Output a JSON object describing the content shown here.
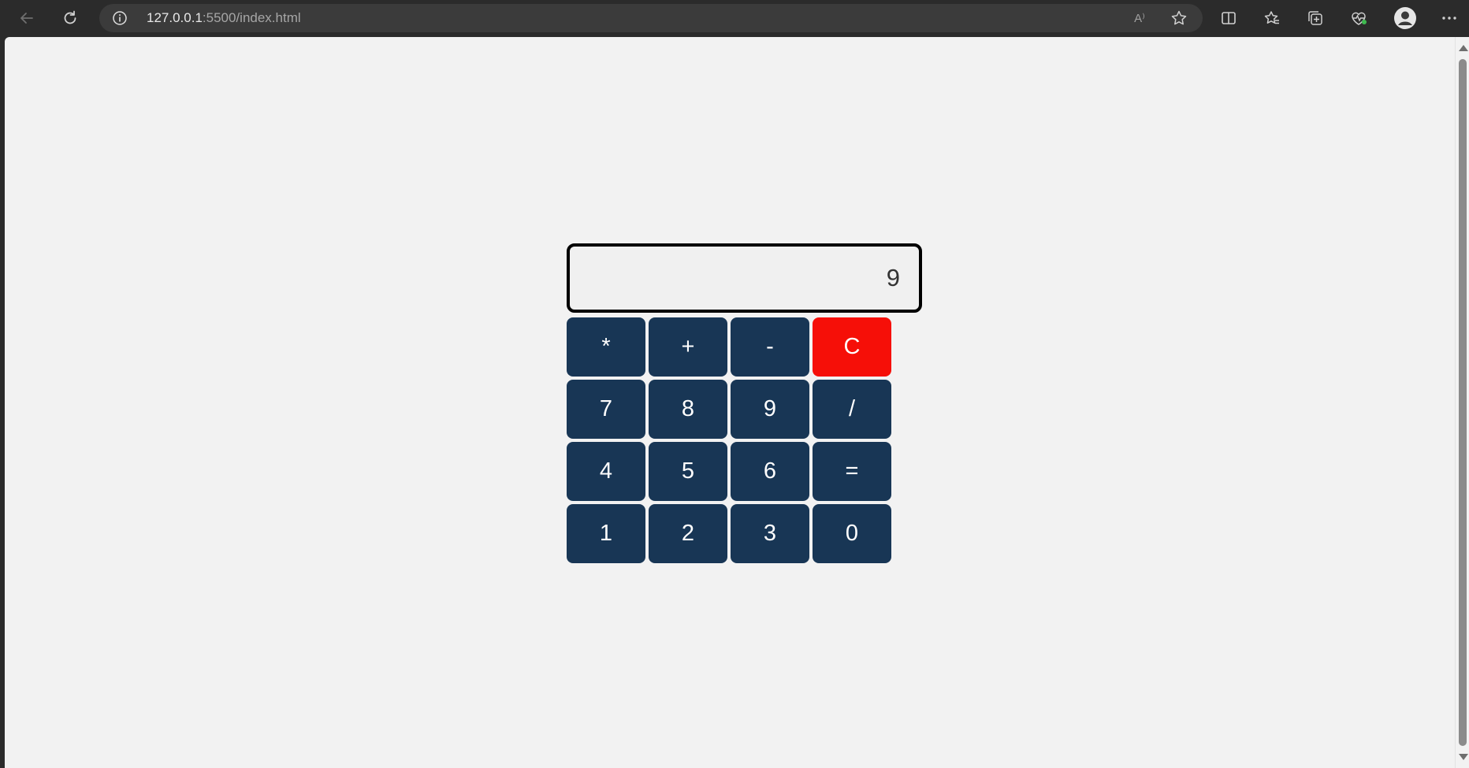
{
  "browser": {
    "url_host": "127.0.0.1",
    "url_path": ":5500/index.html",
    "read_aloud_label": "A⁾",
    "icons": [
      "back-arrow-icon",
      "refresh-icon",
      "info-icon",
      "read-aloud-icon",
      "favorite-star-icon",
      "split-screen-icon",
      "favorites-icon",
      "collections-icon",
      "browser-essentials-icon",
      "profile-icon",
      "more-menu-icon"
    ]
  },
  "calculator": {
    "display_value": "9",
    "keys": [
      {
        "label": "*",
        "name": "multiply-key",
        "type": "operator"
      },
      {
        "label": "+",
        "name": "plus-key",
        "type": "operator"
      },
      {
        "label": "-",
        "name": "minus-key",
        "type": "operator"
      },
      {
        "label": "C",
        "name": "clear-key",
        "type": "clear"
      },
      {
        "label": "7",
        "name": "digit-7-key",
        "type": "digit"
      },
      {
        "label": "8",
        "name": "digit-8-key",
        "type": "digit"
      },
      {
        "label": "9",
        "name": "digit-9-key",
        "type": "digit"
      },
      {
        "label": "/",
        "name": "divide-key",
        "type": "operator"
      },
      {
        "label": "4",
        "name": "digit-4-key",
        "type": "digit"
      },
      {
        "label": "5",
        "name": "digit-5-key",
        "type": "digit"
      },
      {
        "label": "6",
        "name": "digit-6-key",
        "type": "digit"
      },
      {
        "label": "=",
        "name": "equals-key",
        "type": "operator"
      },
      {
        "label": "1",
        "name": "digit-1-key",
        "type": "digit"
      },
      {
        "label": "2",
        "name": "digit-2-key",
        "type": "digit"
      },
      {
        "label": "3",
        "name": "digit-3-key",
        "type": "digit"
      },
      {
        "label": "0",
        "name": "digit-0-key",
        "type": "digit"
      }
    ]
  },
  "colors": {
    "key_background": "#183655",
    "clear_key_background": "#f60f08",
    "page_background": "#f2f2f2",
    "chrome_background": "#2b2b2b"
  }
}
